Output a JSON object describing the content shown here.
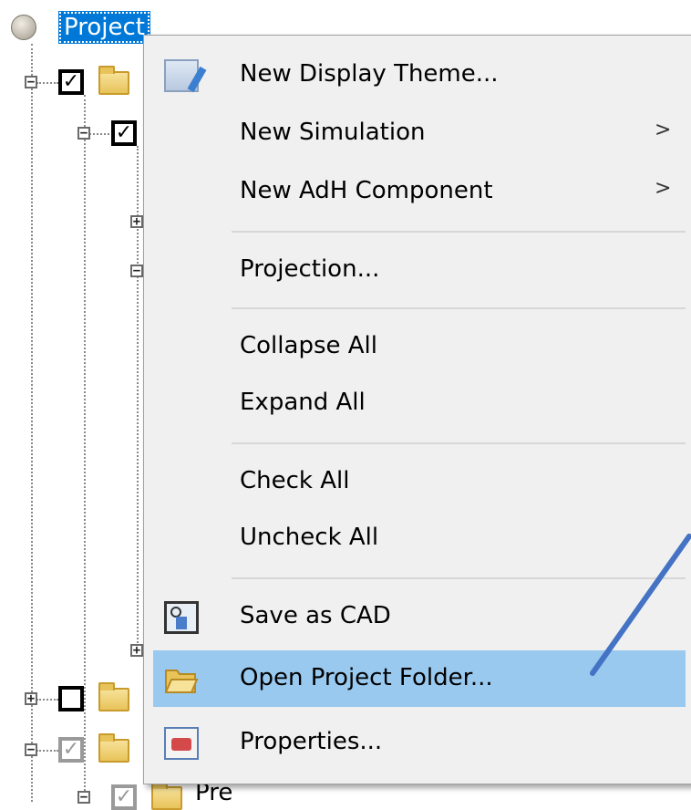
{
  "tree": {
    "root_label": "Project",
    "partial_label": "Pre"
  },
  "menu": {
    "items": [
      {
        "label": "New Display Theme...",
        "icon": "display-theme-icon",
        "submenu": false
      },
      {
        "label": "New Simulation",
        "submenu": true
      },
      {
        "label": "New AdH Component",
        "submenu": true
      },
      {
        "label": "Projection...",
        "submenu": false
      },
      {
        "label": "Collapse All",
        "submenu": false
      },
      {
        "label": "Expand All",
        "submenu": false
      },
      {
        "label": "Check All",
        "submenu": false
      },
      {
        "label": "Uncheck All",
        "submenu": false
      },
      {
        "label": "Save as CAD",
        "icon": "cad-icon",
        "submenu": false
      },
      {
        "label": "Open Project Folder...",
        "icon": "folder-open-icon",
        "submenu": false,
        "highlighted": true
      },
      {
        "label": "Properties...",
        "icon": "properties-icon",
        "submenu": false
      }
    ],
    "submenu_arrow": ">"
  },
  "colors": {
    "selection": "#0078d7",
    "menu_highlight": "#99c9ef",
    "menu_background": "#f0f0f0",
    "annotation_line": "#4472c4"
  }
}
